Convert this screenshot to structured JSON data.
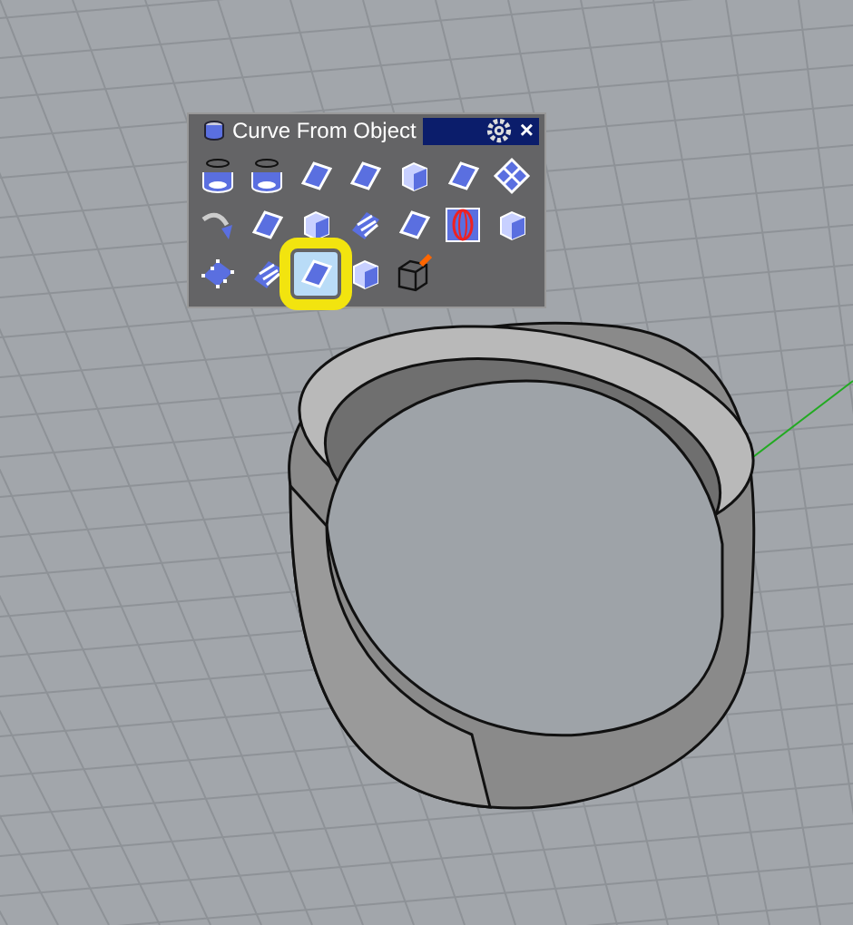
{
  "toolbar": {
    "title": "Curve From Object",
    "close": "×",
    "buttons": [
      {
        "kind": "cylinder",
        "selected": false
      },
      {
        "kind": "cylinder",
        "selected": false
      },
      {
        "kind": "panel",
        "selected": false
      },
      {
        "kind": "panel",
        "selected": false
      },
      {
        "kind": "box",
        "selected": false
      },
      {
        "kind": "panel",
        "selected": false
      },
      {
        "kind": "grid",
        "selected": false
      },
      {
        "kind": "arrow",
        "selected": false
      },
      {
        "kind": "panel",
        "selected": false
      },
      {
        "kind": "box",
        "selected": false
      },
      {
        "kind": "strips",
        "selected": false
      },
      {
        "kind": "panel",
        "selected": false
      },
      {
        "kind": "sphere",
        "selected": false
      },
      {
        "kind": "box",
        "selected": false
      },
      {
        "kind": "points",
        "selected": false
      },
      {
        "kind": "strips",
        "selected": false
      },
      {
        "kind": "panel",
        "selected": true
      },
      {
        "kind": "box",
        "selected": false
      },
      {
        "kind": "wirebox",
        "selected": false
      }
    ]
  }
}
